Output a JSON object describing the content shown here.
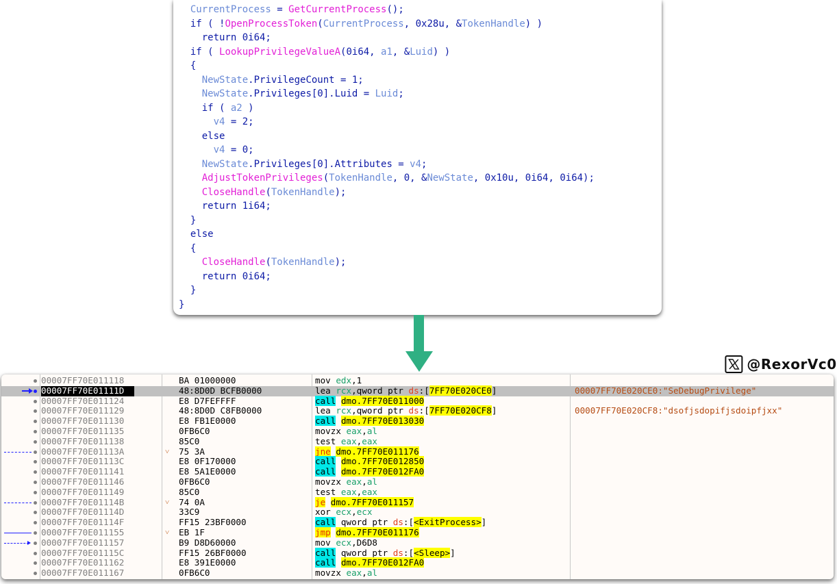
{
  "pseudocode": {
    "lines": [
      [
        {
          "t": "  "
        },
        {
          "t": "CurrentProcess",
          "c": "var"
        },
        {
          "t": " = "
        },
        {
          "t": "GetCurrentProcess",
          "c": "fn"
        },
        {
          "t": "();"
        }
      ],
      [
        {
          "t": "  if ( !"
        },
        {
          "t": "OpenProcessToken",
          "c": "fn"
        },
        {
          "t": "("
        },
        {
          "t": "CurrentProcess",
          "c": "var"
        },
        {
          "t": ", 0x28u, &"
        },
        {
          "t": "TokenHandle",
          "c": "var"
        },
        {
          "t": ") )"
        }
      ],
      [
        {
          "t": "    return 0i64;"
        }
      ],
      [
        {
          "t": "  if ( "
        },
        {
          "t": "LookupPrivilegeValueA",
          "c": "fn"
        },
        {
          "t": "(0i64, "
        },
        {
          "t": "a1",
          "c": "var"
        },
        {
          "t": ", &"
        },
        {
          "t": "Luid",
          "c": "var"
        },
        {
          "t": ") )"
        }
      ],
      [
        {
          "t": "  {"
        }
      ],
      [
        {
          "t": "    "
        },
        {
          "t": "NewState",
          "c": "var"
        },
        {
          "t": ".PrivilegeCount = 1;"
        }
      ],
      [
        {
          "t": "    "
        },
        {
          "t": "NewState",
          "c": "var"
        },
        {
          "t": ".Privileges[0].Luid = "
        },
        {
          "t": "Luid",
          "c": "var"
        },
        {
          "t": ";"
        }
      ],
      [
        {
          "t": "    if ( "
        },
        {
          "t": "a2",
          "c": "var"
        },
        {
          "t": " )"
        }
      ],
      [
        {
          "t": "      "
        },
        {
          "t": "v4",
          "c": "var"
        },
        {
          "t": " = 2;"
        }
      ],
      [
        {
          "t": "    else"
        }
      ],
      [
        {
          "t": "      "
        },
        {
          "t": "v4",
          "c": "var"
        },
        {
          "t": " = 0;"
        }
      ],
      [
        {
          "t": "    "
        },
        {
          "t": "NewState",
          "c": "var"
        },
        {
          "t": ".Privileges[0].Attributes = "
        },
        {
          "t": "v4",
          "c": "var"
        },
        {
          "t": ";"
        }
      ],
      [
        {
          "t": "    "
        },
        {
          "t": "AdjustTokenPrivileges",
          "c": "fn"
        },
        {
          "t": "("
        },
        {
          "t": "TokenHandle",
          "c": "var"
        },
        {
          "t": ", 0, &"
        },
        {
          "t": "NewState",
          "c": "var"
        },
        {
          "t": ", 0x10u, 0i64, 0i64);"
        }
      ],
      [
        {
          "t": "    "
        },
        {
          "t": "CloseHandle",
          "c": "fn"
        },
        {
          "t": "("
        },
        {
          "t": "TokenHandle",
          "c": "var"
        },
        {
          "t": ");"
        }
      ],
      [
        {
          "t": "    return 1i64;"
        }
      ],
      [
        {
          "t": "  }"
        }
      ],
      [
        {
          "t": "  else"
        }
      ],
      [
        {
          "t": "  {"
        }
      ],
      [
        {
          "t": "    "
        },
        {
          "t": "CloseHandle",
          "c": "fn"
        },
        {
          "t": "("
        },
        {
          "t": "TokenHandle",
          "c": "var"
        },
        {
          "t": ");"
        }
      ],
      [
        {
          "t": "    return 0i64;"
        }
      ],
      [
        {
          "t": "  }"
        }
      ],
      [
        {
          "t": "}"
        }
      ]
    ]
  },
  "arrow": {
    "color": "#2fb083",
    "icon": "arrow-down-icon"
  },
  "watermark": {
    "icon": "x-logo-icon",
    "handle": "@RexorVc0"
  },
  "disassembly": {
    "rows": [
      {
        "addr": "00007FF70E011118",
        "bytes": "BA 01000000",
        "instr": [
          {
            "t": "mov "
          },
          {
            "t": "edx",
            "c": "reg"
          },
          {
            "t": ",1"
          }
        ],
        "comment": ""
      },
      {
        "addr": "00007FF70E01111D",
        "bytes": "48:8D0D BCFB0000",
        "selected": true,
        "instr": [
          {
            "t": "lea "
          },
          {
            "t": "rcx",
            "c": "reg"
          },
          {
            "t": ",qword ptr "
          },
          {
            "t": "ds",
            "c": "seg"
          },
          {
            "t": ":["
          },
          {
            "t": "7FF70E020CE0",
            "c": "hl"
          },
          {
            "t": "]"
          }
        ],
        "comment": "00007FF70E020CE0:\"SeDebugPrivilege\""
      },
      {
        "addr": "00007FF70E011124",
        "bytes": "E8 D7FEFFFF",
        "instr": [
          {
            "t": "call",
            "c": "call"
          },
          {
            "t": " "
          },
          {
            "t": "dmo.7FF70E011000",
            "c": "hl"
          }
        ],
        "comment": ""
      },
      {
        "addr": "00007FF70E011129",
        "bytes": "48:8D0D C8FB0000",
        "instr": [
          {
            "t": "lea "
          },
          {
            "t": "rcx",
            "c": "reg"
          },
          {
            "t": ",qword ptr "
          },
          {
            "t": "ds",
            "c": "seg"
          },
          {
            "t": ":["
          },
          {
            "t": "7FF70E020CF8",
            "c": "hl"
          },
          {
            "t": "]"
          }
        ],
        "comment": "00007FF70E020CF8:\"dsofjsdopifjsdoipfjxx\""
      },
      {
        "addr": "00007FF70E011130",
        "bytes": "E8 FB1E0000",
        "instr": [
          {
            "t": "call",
            "c": "call"
          },
          {
            "t": " "
          },
          {
            "t": "dmo.7FF70E013030",
            "c": "hl"
          }
        ],
        "comment": ""
      },
      {
        "addr": "00007FF70E011135",
        "bytes": "0FB6C0",
        "instr": [
          {
            "t": "movzx "
          },
          {
            "t": "eax",
            "c": "reg"
          },
          {
            "t": ","
          },
          {
            "t": "al",
            "c": "reg"
          }
        ],
        "comment": ""
      },
      {
        "addr": "00007FF70E011138",
        "bytes": "85C0",
        "instr": [
          {
            "t": "test "
          },
          {
            "t": "eax",
            "c": "reg"
          },
          {
            "t": ","
          },
          {
            "t": "eax",
            "c": "reg"
          }
        ],
        "comment": ""
      },
      {
        "addr": "00007FF70E01113A",
        "bytes": "75 3A",
        "jmp": true,
        "instr": [
          {
            "t": "jne",
            "c": "jmp"
          },
          {
            "t": " "
          },
          {
            "t": "dmo.7FF70E011176",
            "c": "hl"
          }
        ],
        "comment": ""
      },
      {
        "addr": "00007FF70E01113C",
        "bytes": "E8 0F170000",
        "instr": [
          {
            "t": "call",
            "c": "call"
          },
          {
            "t": " "
          },
          {
            "t": "dmo.7FF70E012850",
            "c": "hl"
          }
        ],
        "comment": ""
      },
      {
        "addr": "00007FF70E011141",
        "bytes": "E8 5A1E0000",
        "instr": [
          {
            "t": "call",
            "c": "call"
          },
          {
            "t": " "
          },
          {
            "t": "dmo.7FF70E012FA0",
            "c": "hl"
          }
        ],
        "comment": ""
      },
      {
        "addr": "00007FF70E011146",
        "bytes": "0FB6C0",
        "instr": [
          {
            "t": "movzx "
          },
          {
            "t": "eax",
            "c": "reg"
          },
          {
            "t": ","
          },
          {
            "t": "al",
            "c": "reg"
          }
        ],
        "comment": ""
      },
      {
        "addr": "00007FF70E011149",
        "bytes": "85C0",
        "instr": [
          {
            "t": "test "
          },
          {
            "t": "eax",
            "c": "reg"
          },
          {
            "t": ","
          },
          {
            "t": "eax",
            "c": "reg"
          }
        ],
        "comment": ""
      },
      {
        "addr": "00007FF70E01114B",
        "bytes": "74 0A",
        "jmp": true,
        "instr": [
          {
            "t": "je",
            "c": "jmp"
          },
          {
            "t": " "
          },
          {
            "t": "dmo.7FF70E011157",
            "c": "hl"
          }
        ],
        "comment": ""
      },
      {
        "addr": "00007FF70E01114D",
        "bytes": "33C9",
        "instr": [
          {
            "t": "xor "
          },
          {
            "t": "ecx",
            "c": "reg"
          },
          {
            "t": ","
          },
          {
            "t": "ecx",
            "c": "reg"
          }
        ],
        "comment": ""
      },
      {
        "addr": "00007FF70E01114F",
        "bytes": "FF15 23BF0000",
        "instr": [
          {
            "t": "call",
            "c": "call"
          },
          {
            "t": " qword ptr "
          },
          {
            "t": "ds",
            "c": "seg"
          },
          {
            "t": ":["
          },
          {
            "t": "<ExitProcess>",
            "c": "hl"
          },
          {
            "t": "]"
          }
        ],
        "comment": ""
      },
      {
        "addr": "00007FF70E011155",
        "bytes": "EB 1F",
        "jmp": true,
        "instr": [
          {
            "t": "jmp",
            "c": "jmp"
          },
          {
            "t": " "
          },
          {
            "t": "dmo.7FF70E011176",
            "c": "hl"
          }
        ],
        "comment": ""
      },
      {
        "addr": "00007FF70E011157",
        "bytes": "B9 D8D60000",
        "instr": [
          {
            "t": "mov "
          },
          {
            "t": "ecx",
            "c": "reg"
          },
          {
            "t": ",D6D8"
          }
        ],
        "comment": ""
      },
      {
        "addr": "00007FF70E01115C",
        "bytes": "FF15 26BF0000",
        "instr": [
          {
            "t": "call",
            "c": "call"
          },
          {
            "t": " qword ptr "
          },
          {
            "t": "ds",
            "c": "seg"
          },
          {
            "t": ":["
          },
          {
            "t": "<Sleep>",
            "c": "hl"
          },
          {
            "t": "]"
          }
        ],
        "comment": ""
      },
      {
        "addr": "00007FF70E011162",
        "bytes": "E8 391E0000",
        "instr": [
          {
            "t": "call",
            "c": "call"
          },
          {
            "t": " "
          },
          {
            "t": "dmo.7FF70E012FA0",
            "c": "hl"
          }
        ],
        "comment": ""
      },
      {
        "addr": "00007FF70E011167",
        "bytes": "0FB6C0",
        "instr": [
          {
            "t": "movzx "
          },
          {
            "t": "eax",
            "c": "reg"
          },
          {
            "t": ","
          },
          {
            "t": "al",
            "c": "reg"
          }
        ],
        "comment": ""
      }
    ],
    "colors": {
      "selection": "#c0c0c0",
      "call_highlight": "#00e8e8",
      "operand_highlight": "#ffff00",
      "register": "#1aa06a",
      "segment": "#e04020",
      "comment": "#b54c14",
      "rip_arrow": "#1e1eff"
    }
  }
}
